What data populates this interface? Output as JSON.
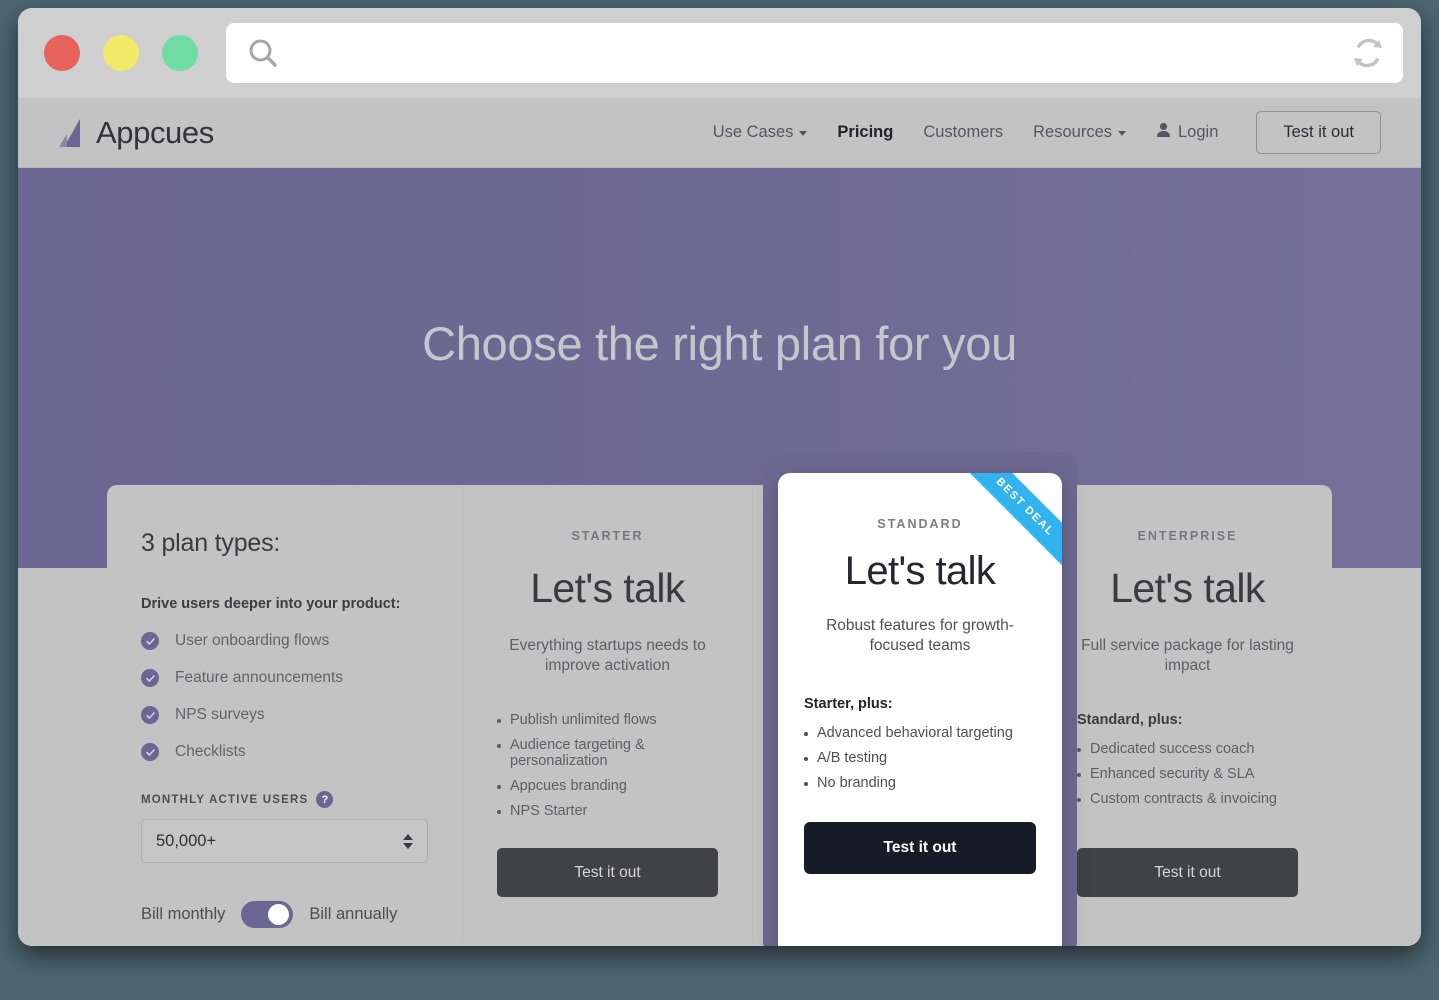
{
  "browser": {
    "traffic_lights": [
      "close",
      "minimize",
      "maximize"
    ],
    "address_value": "",
    "address_placeholder": "",
    "search_icon": "search-icon",
    "reload_icon": "reload-icon"
  },
  "header": {
    "brand": "Appcues",
    "nav": [
      {
        "label": "Use Cases",
        "has_caret": true,
        "active": false
      },
      {
        "label": "Pricing",
        "has_caret": false,
        "active": true
      },
      {
        "label": "Customers",
        "has_caret": false,
        "active": false
      },
      {
        "label": "Resources",
        "has_caret": true,
        "active": false
      }
    ],
    "login_label": "Login",
    "cta_label": "Test it out"
  },
  "hero": {
    "title": "Choose the right plan for you",
    "background_color": "#6e6992"
  },
  "plan_types": {
    "title": "3 plan types:",
    "subtitle": "Drive users deeper into your product:",
    "features": [
      "User onboarding flows",
      "Feature announcements",
      "NPS surveys",
      "Checklists"
    ],
    "mau_label": "MONTHLY ACTIVE USERS",
    "mau_help": "?",
    "mau_value": "50,000+",
    "billing": {
      "left_label": "Bill monthly",
      "right_label": "Bill annually",
      "state": "monthly"
    }
  },
  "plans": [
    {
      "eyebrow": "STARTER",
      "price": "Let's talk",
      "description": "Everything startups needs to improve activation",
      "group_title": "",
      "bullets": [
        "Publish unlimited flows",
        "Audience targeting & personalization",
        "Appcues branding",
        "NPS Starter"
      ],
      "cta": "Test it out",
      "highlighted": false
    },
    {
      "eyebrow": "ENTERPRISE",
      "price": "Let's talk",
      "description": "Full service package for lasting impact",
      "group_title": "Standard, plus:",
      "bullets": [
        "Dedicated success coach",
        "Enhanced security & SLA",
        "Custom contracts & invoicing"
      ],
      "cta": "Test it out",
      "highlighted": false
    }
  ],
  "highlighted_plan": {
    "ribbon": "BEST DEAL",
    "ribbon_color": "#32b3ef",
    "eyebrow": "STANDARD",
    "price": "Let's talk",
    "description": "Robust features for growth-focused teams",
    "group_title": "Starter, plus:",
    "bullets": [
      "Advanced behavioral targeting",
      "A/B testing",
      "No branding"
    ],
    "cta": "Test it out"
  },
  "colors": {
    "page_background": "#4d6670",
    "brand_purple": "#6b6694",
    "hero_purple": "#6e6992",
    "surface_gray": "#c3c3c3",
    "accent_blue": "#32b3ef",
    "dark_button": "#414246",
    "highlight_button": "#161c27"
  }
}
